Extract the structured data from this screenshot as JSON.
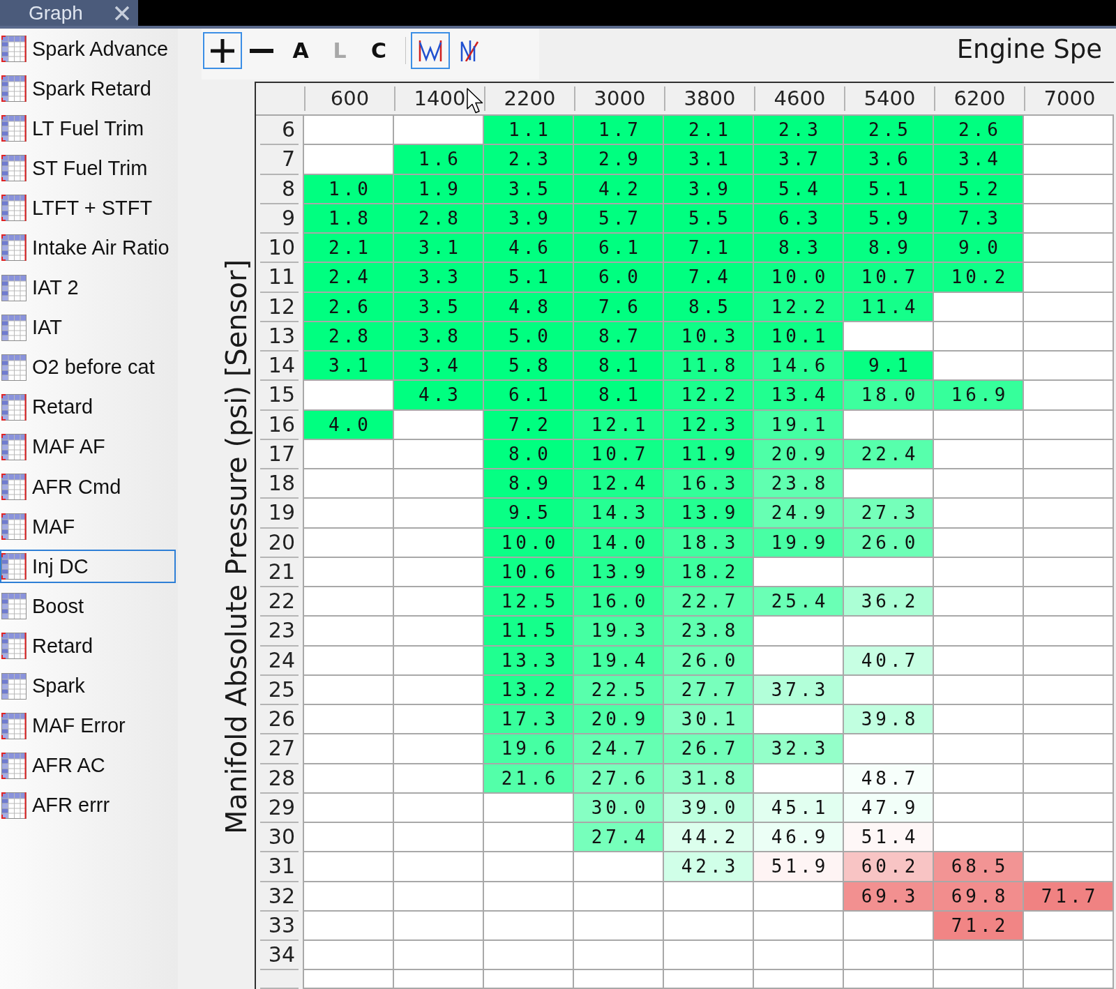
{
  "tabs": [
    {
      "label": "Graph"
    }
  ],
  "sidebar": {
    "items": [
      {
        "label": "Spark Advance",
        "flagged": true,
        "selected": false
      },
      {
        "label": "Spark Retard",
        "flagged": true,
        "selected": false
      },
      {
        "label": "LT Fuel Trim",
        "flagged": true,
        "selected": false
      },
      {
        "label": "ST Fuel Trim",
        "flagged": true,
        "selected": false
      },
      {
        "label": "LTFT + STFT",
        "flagged": true,
        "selected": false
      },
      {
        "label": "Intake Air Ratio",
        "flagged": true,
        "selected": false
      },
      {
        "label": "IAT 2",
        "flagged": false,
        "selected": false
      },
      {
        "label": "IAT",
        "flagged": false,
        "selected": false
      },
      {
        "label": "O2 before cat",
        "flagged": false,
        "selected": false
      },
      {
        "label": "Retard",
        "flagged": true,
        "selected": false
      },
      {
        "label": "MAF AF",
        "flagged": true,
        "selected": false
      },
      {
        "label": "AFR Cmd",
        "flagged": true,
        "selected": false
      },
      {
        "label": "MAF",
        "flagged": true,
        "selected": false
      },
      {
        "label": "Inj DC",
        "flagged": true,
        "selected": true
      },
      {
        "label": "Boost",
        "flagged": false,
        "selected": false
      },
      {
        "label": "Retard",
        "flagged": true,
        "selected": false
      },
      {
        "label": "Spark",
        "flagged": false,
        "selected": false
      },
      {
        "label": "MAF Error",
        "flagged": true,
        "selected": false
      },
      {
        "label": "AFR AC",
        "flagged": true,
        "selected": false
      },
      {
        "label": "AFR errr",
        "flagged": true,
        "selected": false
      }
    ]
  },
  "toolbar": {
    "groups": [
      {
        "items": [
          {
            "kind": "plus",
            "selected": true,
            "disabled": false
          },
          {
            "kind": "minus",
            "selected": false,
            "disabled": false
          },
          {
            "kind": "letter",
            "label": "A",
            "selected": false,
            "disabled": false
          },
          {
            "kind": "letter",
            "label": "L",
            "selected": false,
            "disabled": true
          },
          {
            "kind": "letter",
            "label": "C",
            "selected": false,
            "disabled": false
          }
        ]
      },
      {
        "items": [
          {
            "kind": "graph",
            "selected": true,
            "disabled": false
          },
          {
            "kind": "zigzag",
            "selected": false,
            "disabled": false
          }
        ]
      }
    ]
  },
  "column_axis_label": "Engine Spe",
  "row_axis_label": "Manifold Absolute Pressure (psi) [Sensor]",
  "table": {
    "columns": [
      "600",
      "1400",
      "2200",
      "3000",
      "3800",
      "4600",
      "5400",
      "6200",
      "7000"
    ],
    "rows": [
      {
        "label": "6",
        "cells": [
          null,
          null,
          {
            "value": "1.1",
            "color": "#00ff80"
          },
          {
            "value": "1.7",
            "color": "#00ff80"
          },
          {
            "value": "2.1",
            "color": "#00ff80"
          },
          {
            "value": "2.3",
            "color": "#00ff80"
          },
          {
            "value": "2.5",
            "color": "#00ff80"
          },
          {
            "value": "2.6",
            "color": "#00ff80"
          },
          null
        ]
      },
      {
        "label": "7",
        "cells": [
          null,
          {
            "value": "1.6",
            "color": "#00ff80"
          },
          {
            "value": "2.3",
            "color": "#00ff80"
          },
          {
            "value": "2.9",
            "color": "#00ff80"
          },
          {
            "value": "3.1",
            "color": "#00ff80"
          },
          {
            "value": "3.7",
            "color": "#00ff80"
          },
          {
            "value": "3.6",
            "color": "#00ff80"
          },
          {
            "value": "3.4",
            "color": "#00ff80"
          },
          null
        ]
      },
      {
        "label": "8",
        "cells": [
          {
            "value": "1.0",
            "color": "#00ff80"
          },
          {
            "value": "1.9",
            "color": "#00ff80"
          },
          {
            "value": "3.5",
            "color": "#00ff80"
          },
          {
            "value": "4.2",
            "color": "#00ff80"
          },
          {
            "value": "3.9",
            "color": "#00ff80"
          },
          {
            "value": "5.4",
            "color": "#00ff80"
          },
          {
            "value": "5.1",
            "color": "#00ff80"
          },
          {
            "value": "5.2",
            "color": "#00ff80"
          },
          null
        ]
      },
      {
        "label": "9",
        "cells": [
          {
            "value": "1.8",
            "color": "#00ff80"
          },
          {
            "value": "2.8",
            "color": "#00ff80"
          },
          {
            "value": "3.9",
            "color": "#00ff80"
          },
          {
            "value": "5.7",
            "color": "#00ff80"
          },
          {
            "value": "5.5",
            "color": "#00ff80"
          },
          {
            "value": "6.3",
            "color": "#00ff80"
          },
          {
            "value": "5.9",
            "color": "#00ff80"
          },
          {
            "value": "7.3",
            "color": "#00ff80"
          },
          null
        ]
      },
      {
        "label": "10",
        "cells": [
          {
            "value": "2.1",
            "color": "#00ff80"
          },
          {
            "value": "3.1",
            "color": "#00ff80"
          },
          {
            "value": "4.6",
            "color": "#00ff80"
          },
          {
            "value": "6.1",
            "color": "#00ff80"
          },
          {
            "value": "7.1",
            "color": "#00ff80"
          },
          {
            "value": "8.3",
            "color": "#02ff81"
          },
          {
            "value": "8.9",
            "color": "#05ff83"
          },
          {
            "value": "9.0",
            "color": "#06ff83"
          },
          null
        ]
      },
      {
        "label": "11",
        "cells": [
          {
            "value": "2.4",
            "color": "#00ff80"
          },
          {
            "value": "3.3",
            "color": "#00ff80"
          },
          {
            "value": "5.1",
            "color": "#00ff80"
          },
          {
            "value": "6.0",
            "color": "#00ff80"
          },
          {
            "value": "7.4",
            "color": "#00ff80"
          },
          {
            "value": "10.0",
            "color": "#0cff86"
          },
          {
            "value": "10.7",
            "color": "#10ff88"
          },
          {
            "value": "10.2",
            "color": "#0dff87"
          },
          null
        ]
      },
      {
        "label": "12",
        "cells": [
          {
            "value": "2.6",
            "color": "#00ff80"
          },
          {
            "value": "3.5",
            "color": "#00ff80"
          },
          {
            "value": "4.8",
            "color": "#00ff80"
          },
          {
            "value": "7.6",
            "color": "#00ff80"
          },
          {
            "value": "8.5",
            "color": "#03ff82"
          },
          {
            "value": "12.2",
            "color": "#1aff8d"
          },
          {
            "value": "11.4",
            "color": "#15ff8a"
          },
          null,
          null
        ]
      },
      {
        "label": "13",
        "cells": [
          {
            "value": "2.8",
            "color": "#00ff80"
          },
          {
            "value": "3.8",
            "color": "#00ff80"
          },
          {
            "value": "5.0",
            "color": "#00ff80"
          },
          {
            "value": "8.7",
            "color": "#04ff82"
          },
          {
            "value": "10.3",
            "color": "#0eff87"
          },
          {
            "value": "10.1",
            "color": "#0dff86"
          },
          null,
          null,
          null
        ]
      },
      {
        "label": "14",
        "cells": [
          {
            "value": "3.1",
            "color": "#00ff80"
          },
          {
            "value": "3.4",
            "color": "#00ff80"
          },
          {
            "value": "5.8",
            "color": "#00ff80"
          },
          {
            "value": "8.1",
            "color": "#00ff80"
          },
          {
            "value": "11.8",
            "color": "#17ff8b"
          },
          {
            "value": "14.6",
            "color": "#28ff94"
          },
          {
            "value": "9.1",
            "color": "#07ff83"
          },
          null,
          null
        ]
      },
      {
        "label": "15",
        "cells": [
          null,
          {
            "value": "4.3",
            "color": "#00ff80"
          },
          {
            "value": "6.1",
            "color": "#00ff80"
          },
          {
            "value": "8.1",
            "color": "#00ff80"
          },
          {
            "value": "12.2",
            "color": "#1aff8d"
          },
          {
            "value": "13.4",
            "color": "#21ff90"
          },
          {
            "value": "18.0",
            "color": "#3dff9e"
          },
          {
            "value": "16.9",
            "color": "#36ff9b"
          },
          null
        ]
      },
      {
        "label": "16",
        "cells": [
          {
            "value": "4.0",
            "color": "#00ff80"
          },
          null,
          {
            "value": "7.2",
            "color": "#00ff80"
          },
          {
            "value": "12.1",
            "color": "#19ff8c"
          },
          {
            "value": "12.3",
            "color": "#1aff8d"
          },
          {
            "value": "19.1",
            "color": "#43ffa2"
          },
          null,
          null,
          null
        ]
      },
      {
        "label": "17",
        "cells": [
          null,
          null,
          {
            "value": "8.0",
            "color": "#00ff80"
          },
          {
            "value": "10.7",
            "color": "#10ff88"
          },
          {
            "value": "11.9",
            "color": "#18ff8c"
          },
          {
            "value": "20.9",
            "color": "#4effa7"
          },
          {
            "value": "22.4",
            "color": "#57ffac"
          },
          null,
          null
        ]
      },
      {
        "label": "18",
        "cells": [
          null,
          null,
          {
            "value": "8.9",
            "color": "#05ff83"
          },
          {
            "value": "12.4",
            "color": "#1bff8d"
          },
          {
            "value": "16.3",
            "color": "#32ff99"
          },
          {
            "value": "23.8",
            "color": "#60ffb0"
          },
          null,
          null,
          null
        ]
      },
      {
        "label": "19",
        "cells": [
          null,
          null,
          {
            "value": "9.5",
            "color": "#09ff85"
          },
          {
            "value": "14.3",
            "color": "#26ff93"
          },
          {
            "value": "13.9",
            "color": "#24ff92"
          },
          {
            "value": "24.9",
            "color": "#67ffb3"
          },
          {
            "value": "27.3",
            "color": "#75ffba"
          },
          null,
          null
        ]
      },
      {
        "label": "20",
        "cells": [
          null,
          null,
          {
            "value": "10.0",
            "color": "#0cff86"
          },
          {
            "value": "14.0",
            "color": "#24ff92"
          },
          {
            "value": "18.3",
            "color": "#3fff9f"
          },
          {
            "value": "19.9",
            "color": "#48ffa4"
          },
          {
            "value": "26.0",
            "color": "#6dffb6"
          },
          null,
          null
        ]
      },
      {
        "label": "21",
        "cells": [
          null,
          null,
          {
            "value": "10.6",
            "color": "#10ff88"
          },
          {
            "value": "13.9",
            "color": "#24ff92"
          },
          {
            "value": "18.2",
            "color": "#3eff9f"
          },
          null,
          null,
          null,
          null
        ]
      },
      {
        "label": "22",
        "cells": [
          null,
          null,
          {
            "value": "12.5",
            "color": "#1bff8e"
          },
          {
            "value": "16.0",
            "color": "#31ff98"
          },
          {
            "value": "22.7",
            "color": "#59ffac"
          },
          {
            "value": "25.4",
            "color": "#6affb5"
          },
          {
            "value": "36.2",
            "color": "#abffd5"
          },
          null,
          null
        ]
      },
      {
        "label": "23",
        "cells": [
          null,
          null,
          {
            "value": "11.5",
            "color": "#15ff8b"
          },
          {
            "value": "19.3",
            "color": "#45ffa2"
          },
          {
            "value": "23.8",
            "color": "#60ffb0"
          },
          null,
          null,
          null,
          null
        ]
      },
      {
        "label": "24",
        "cells": [
          null,
          null,
          {
            "value": "13.3",
            "color": "#20ff90"
          },
          {
            "value": "19.4",
            "color": "#45ffa2"
          },
          {
            "value": "26.0",
            "color": "#6dffb6"
          },
          null,
          {
            "value": "40.7",
            "color": "#c7ffe3"
          },
          null,
          null
        ]
      },
      {
        "label": "25",
        "cells": [
          null,
          null,
          {
            "value": "13.2",
            "color": "#20ff90"
          },
          {
            "value": "22.5",
            "color": "#58ffac"
          },
          {
            "value": "27.7",
            "color": "#78ffbc"
          },
          {
            "value": "37.3",
            "color": "#b2ffd9"
          },
          null,
          null,
          null
        ]
      },
      {
        "label": "26",
        "cells": [
          null,
          null,
          {
            "value": "17.3",
            "color": "#38ff9c"
          },
          {
            "value": "20.9",
            "color": "#4effa7"
          },
          {
            "value": "30.1",
            "color": "#86ffc3"
          },
          null,
          {
            "value": "39.8",
            "color": "#c1ffe0"
          },
          null,
          null
        ]
      },
      {
        "label": "27",
        "cells": [
          null,
          null,
          {
            "value": "19.6",
            "color": "#46ffa3"
          },
          {
            "value": "24.7",
            "color": "#65ffb2"
          },
          {
            "value": "26.7",
            "color": "#72ffb9"
          },
          {
            "value": "32.3",
            "color": "#94ffc9"
          },
          null,
          null,
          null
        ]
      },
      {
        "label": "28",
        "cells": [
          null,
          null,
          {
            "value": "21.6",
            "color": "#53ffa9"
          },
          {
            "value": "27.6",
            "color": "#77ffbb"
          },
          {
            "value": "31.8",
            "color": "#91ffc8"
          },
          null,
          {
            "value": "48.7",
            "color": "#f7fffb"
          },
          null,
          null
        ]
      },
      {
        "label": "29",
        "cells": [
          null,
          null,
          null,
          {
            "value": "30.0",
            "color": "#86ffc3"
          },
          {
            "value": "39.0",
            "color": "#bcffde"
          },
          {
            "value": "45.1",
            "color": "#e1fff0"
          },
          {
            "value": "47.9",
            "color": "#f2fff9"
          },
          null,
          null
        ]
      },
      {
        "label": "30",
        "cells": [
          null,
          null,
          null,
          {
            "value": "27.4",
            "color": "#76ffbb"
          },
          {
            "value": "44.2",
            "color": "#dcffed"
          },
          {
            "value": "46.9",
            "color": "#ecfff6"
          },
          {
            "value": "51.4",
            "color": "#fef7f7"
          },
          null,
          null
        ]
      },
      {
        "label": "31",
        "cells": [
          null,
          null,
          null,
          null,
          {
            "value": "42.3",
            "color": "#d0ffe8"
          },
          {
            "value": "51.9",
            "color": "#fef4f4"
          },
          {
            "value": "60.2",
            "color": "#f8c4c4"
          },
          {
            "value": "68.5",
            "color": "#f29494"
          },
          null
        ]
      },
      {
        "label": "32",
        "cells": [
          null,
          null,
          null,
          null,
          null,
          null,
          {
            "value": "69.3",
            "color": "#f29090"
          },
          {
            "value": "69.8",
            "color": "#f28d8d"
          },
          {
            "value": "71.7",
            "color": "#f08282"
          }
        ]
      },
      {
        "label": "33",
        "cells": [
          null,
          null,
          null,
          null,
          null,
          null,
          null,
          {
            "value": "71.2",
            "color": "#f18585"
          },
          null
        ]
      },
      {
        "label": "34",
        "cells": [
          null,
          null,
          null,
          null,
          null,
          null,
          null,
          null,
          null
        ]
      },
      {
        "cells": [
          null,
          null,
          null,
          null,
          null,
          null,
          null,
          null,
          null
        ]
      }
    ]
  }
}
